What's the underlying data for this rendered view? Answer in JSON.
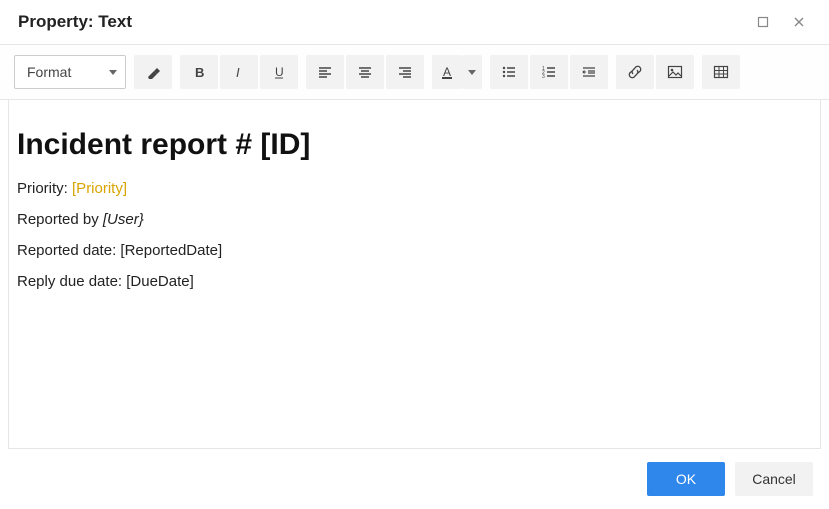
{
  "dialog": {
    "title": "Property: Text"
  },
  "toolbar": {
    "format_label": "Format"
  },
  "content": {
    "heading": "Incident report # [ID]",
    "priority_label": "Priority: ",
    "priority_value": "[Priority]",
    "reported_by_label": "Reported by ",
    "reported_by_value": "[User}",
    "reported_date_label": "Reported date: ",
    "reported_date_value": "[ReportedDate]",
    "due_date_label": "Reply due date: ",
    "due_date_value": "[DueDate]"
  },
  "footer": {
    "ok": "OK",
    "cancel": "Cancel"
  }
}
